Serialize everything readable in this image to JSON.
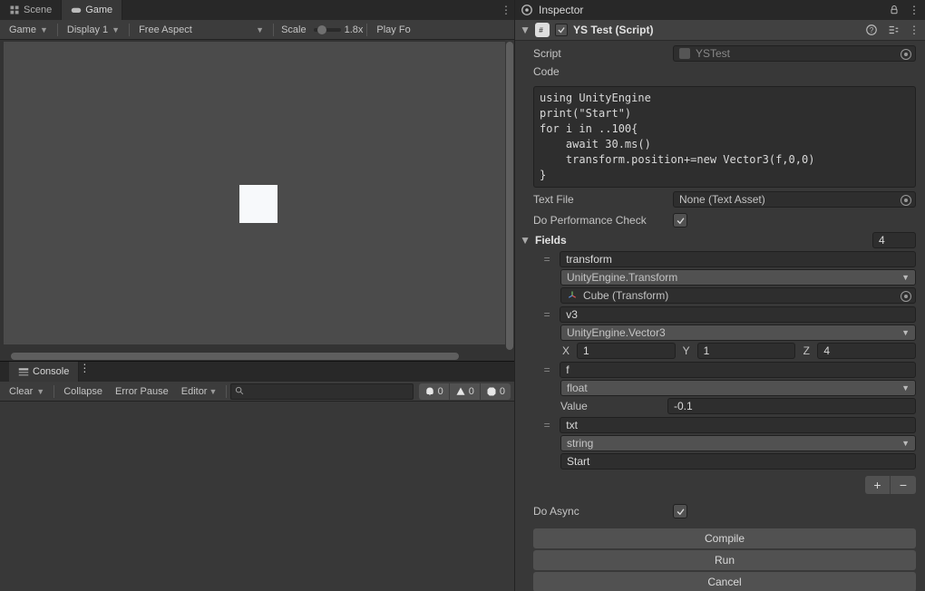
{
  "tabs": {
    "scene": "Scene",
    "game": "Game"
  },
  "game_toolbar": {
    "game_dd": "Game",
    "display_dd": "Display 1",
    "aspect_dd": "Free Aspect",
    "scale_label": "Scale",
    "scale_value": "1.8x",
    "play_focus": "Play Fo"
  },
  "console": {
    "tab": "Console",
    "clear": "Clear",
    "collapse": "Collapse",
    "error_pause": "Error Pause",
    "editor": "Editor",
    "info_count": "0",
    "warn_count": "0",
    "error_count": "0"
  },
  "inspector": {
    "tab": "Inspector",
    "component_title": "YS Test (Script)",
    "script_label": "Script",
    "script_value": "YSTest",
    "code_label": "Code",
    "code_text": "using UnityEngine\nprint(\"Start\")\nfor i in ..100{\n    await 30.ms()\n    transform.position+=new Vector3(f,0,0)\n}",
    "text_file_label": "Text File",
    "text_file_value": "None (Text Asset)",
    "perf_label": "Do Performance Check",
    "perf_checked": true,
    "fields_label": "Fields",
    "fields_count": "4",
    "do_async_label": "Do Async",
    "do_async_checked": true,
    "compile_btn": "Compile",
    "run_btn": "Run",
    "cancel_btn": "Cancel",
    "fields": [
      {
        "name": "transform",
        "type": "UnityEngine.Transform",
        "object_ref": "Cube (Transform)"
      },
      {
        "name": "v3",
        "type": "UnityEngine.Vector3",
        "xyz_labels": {
          "x": "X",
          "y": "Y",
          "z": "Z"
        },
        "xyz": {
          "x": "1",
          "y": "1",
          "z": "4"
        }
      },
      {
        "name": "f",
        "type": "float",
        "value_label": "Value",
        "value": "-0.1"
      },
      {
        "name": "txt",
        "type": "string",
        "value": "Start"
      }
    ]
  }
}
